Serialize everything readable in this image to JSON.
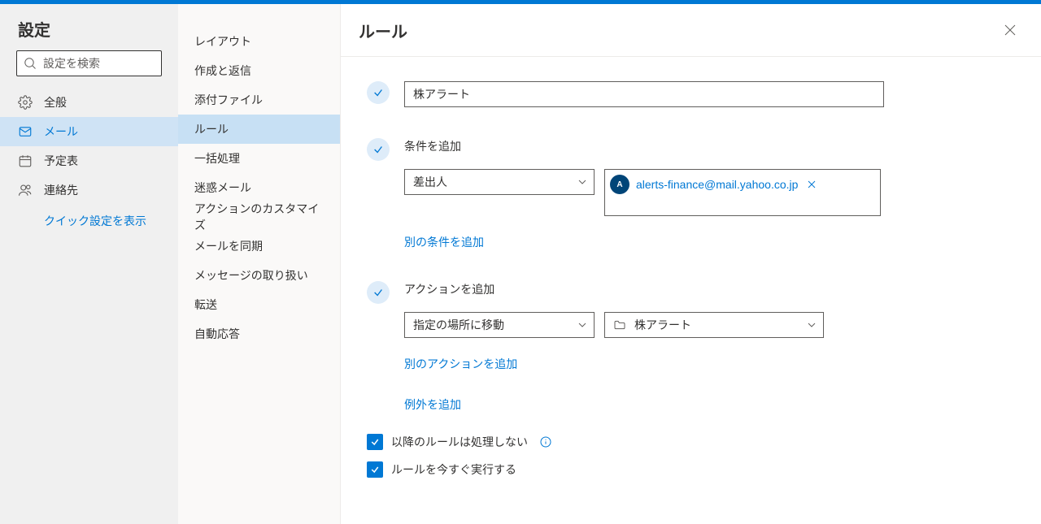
{
  "settings_title": "設定",
  "search": {
    "placeholder": "設定を検索"
  },
  "primary_nav": [
    {
      "key": "general",
      "label": "全般"
    },
    {
      "key": "mail",
      "label": "メール"
    },
    {
      "key": "calendar",
      "label": "予定表"
    },
    {
      "key": "people",
      "label": "連絡先"
    }
  ],
  "quick_settings_link": "クイック設定を表示",
  "secondary_nav": [
    {
      "label": "レイアウト"
    },
    {
      "label": "作成と返信"
    },
    {
      "label": "添付ファイル"
    },
    {
      "label": "ルール"
    },
    {
      "label": "一括処理"
    },
    {
      "label": "迷惑メール"
    },
    {
      "label": "アクションのカスタマイズ"
    },
    {
      "label": "メールを同期"
    },
    {
      "label": "メッセージの取り扱い"
    },
    {
      "label": "転送"
    },
    {
      "label": "自動応答"
    }
  ],
  "rules": {
    "title": "ルール",
    "name_value": "株アラート",
    "condition_section_label": "条件を追加",
    "condition_select": "差出人",
    "sender_email": "alerts-finance@mail.yahoo.co.jp",
    "sender_initial": "A",
    "add_condition_link": "別の条件を追加",
    "action_section_label": "アクションを追加",
    "action_select": "指定の場所に移動",
    "folder_select": "株アラート",
    "add_action_link": "別のアクションを追加",
    "add_exception_link": "例外を追加",
    "stop_processing_label": "以降のルールは処理しない",
    "run_now_label": "ルールを今すぐ実行する"
  }
}
